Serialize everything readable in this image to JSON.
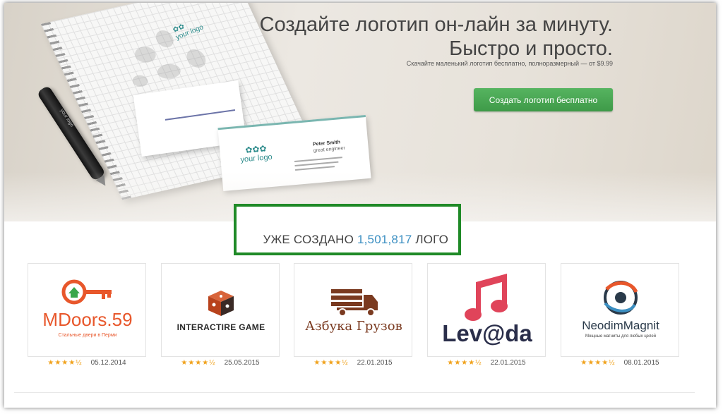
{
  "hero": {
    "headline_line1": "Создайте логотип он-лайн за минуту.",
    "headline_line2": "Быстро и просто.",
    "subtitle": "Скачайте маленький логотип бесплатно, полноразмерный — от $9.99",
    "cta_label": "Создать логотип бесплатно",
    "mockup": {
      "notebook_logo": "your logo",
      "pen_logo": "your logo",
      "card_logo": "your logo",
      "card_name": "Peter Smith",
      "card_title": "great engineer"
    }
  },
  "counter": {
    "prefix": "УЖЕ СОЗДАНО",
    "number": "1,501,817",
    "suffix": "ЛОГО"
  },
  "logos": [
    {
      "name": "MDoors.59",
      "subtitle": "Стальные двери в Перми",
      "date": "05.12.2014",
      "stars": "★★★★½",
      "icon": "key-house-icon",
      "color": "#e8572b"
    },
    {
      "name": "INTERACTIRE GAME",
      "subtitle": "",
      "date": "25.05.2015",
      "stars": "★★★★½",
      "icon": "dice-icon",
      "color": "#c44a1e"
    },
    {
      "name": "Азбука Грузов",
      "subtitle": "",
      "date": "22.01.2015",
      "stars": "★★★★½",
      "icon": "truck-icon",
      "color": "#7a3a20"
    },
    {
      "name": "Lev@da",
      "subtitle": "",
      "date": "22.01.2015",
      "stars": "★★★★½",
      "icon": "music-note-icon",
      "color": "#e0445a"
    },
    {
      "name": "NeodimMagnit",
      "subtitle": "Мощные магниты для любых целей",
      "date": "08.01.2015",
      "stars": "★★★★½",
      "icon": "magnet-orbit-icon",
      "color": "#2a3a4a"
    }
  ],
  "colors": {
    "accent_green": "#4aa954",
    "counter_border": "#1f8a27",
    "counter_number": "#3b8fc2",
    "star": "#f0a21c"
  }
}
